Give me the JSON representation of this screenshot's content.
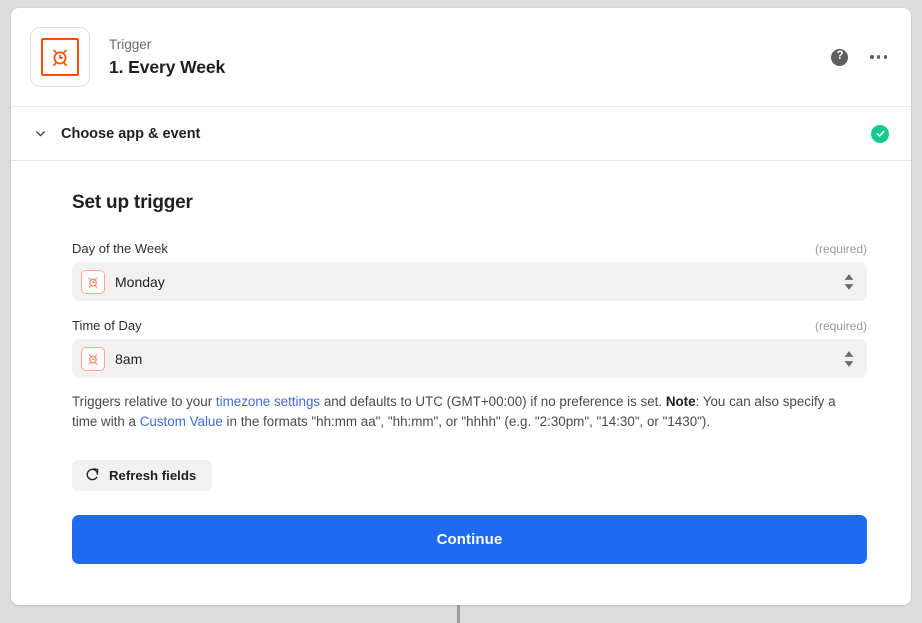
{
  "theme": {
    "page_background": "#dddddd",
    "card_background": "#ffffff",
    "brand_orange": "#ff4f00",
    "accent_blue": "#1e6bf1",
    "link_blue": "#4169e1",
    "success_green": "#16c98d",
    "field_background": "#f1f1f1"
  },
  "header": {
    "app_icon": "alarm-clock-icon",
    "kicker": "Trigger",
    "title": "1. Every Week",
    "help_icon": "help-circle-icon",
    "help_label": "?",
    "more_icon": "more-horizontal-icon"
  },
  "step": {
    "chevron_icon": "chevron-down-icon",
    "label": "Choose app & event",
    "status_icon": "check-circle-icon"
  },
  "setup": {
    "section_title": "Set up trigger",
    "fields": [
      {
        "label": "Day of the Week",
        "required_text": "(required)",
        "value": "Monday",
        "icon": "alarm-clock-icon",
        "stepper_icon": "stepper-updown-icon"
      },
      {
        "label": "Time of Day",
        "required_text": "(required)",
        "value": "8am",
        "icon": "alarm-clock-icon",
        "stepper_icon": "stepper-updown-icon"
      }
    ],
    "helper": {
      "part1": "Triggers relative to your ",
      "link1": "timezone settings",
      "part2": " and defaults to UTC (GMT+00:00) if no preference is set. ",
      "note_label": "Note",
      "part3": ": You can also specify a time with a ",
      "link2": "Custom Value",
      "part4": " in the formats \"hh:mm aa\", \"hh:mm\", or \"hhhh\" (e.g. \"2:30pm\", \"14:30\", or \"1430\")."
    },
    "refresh_button": {
      "icon": "refresh-icon",
      "label": "Refresh fields"
    },
    "continue_button": {
      "label": "Continue"
    }
  }
}
